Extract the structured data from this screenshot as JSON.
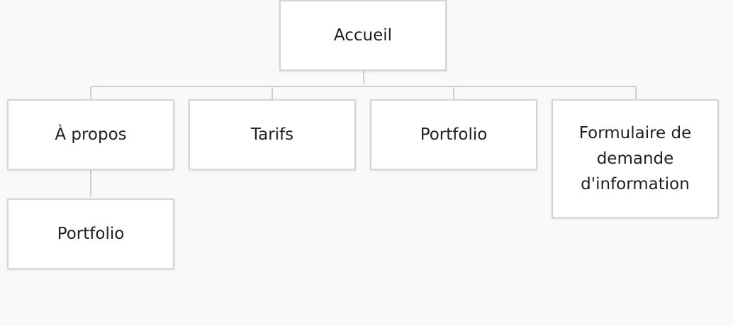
{
  "sitemap": {
    "root": {
      "label": "Accueil"
    },
    "children": [
      {
        "label": "À propos"
      },
      {
        "label": "Tarifs"
      },
      {
        "label": "Portfolio"
      },
      {
        "label": "Formulaire de demande d'information"
      }
    ],
    "grandchildren": [
      {
        "label": "Portfolio"
      }
    ]
  },
  "colors": {
    "background": "#f8f9fb",
    "node_fill": "#ffffff",
    "node_border": "#d6d6d8",
    "connector": "#cfcfd2",
    "text": "#1f1f1f"
  }
}
